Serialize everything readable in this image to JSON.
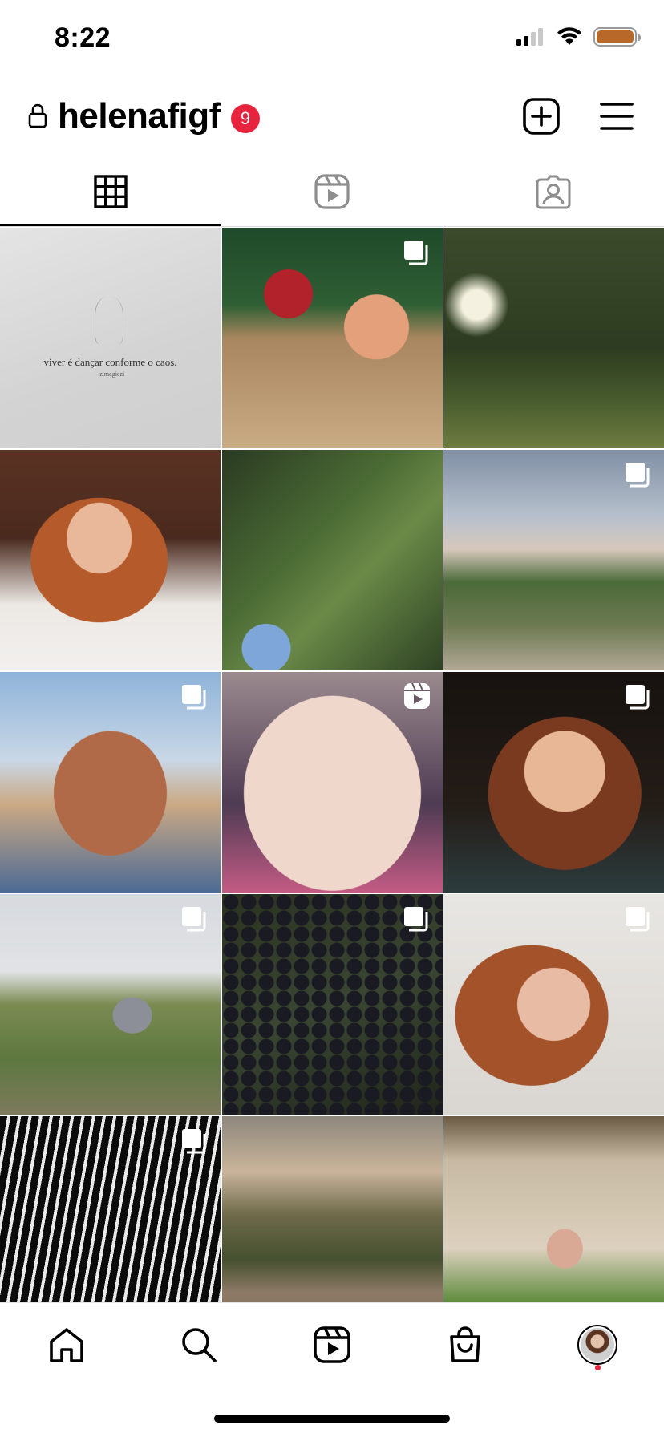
{
  "status_bar": {
    "time": "8:22",
    "signal_icon": "cellular-signal-icon",
    "wifi_icon": "wifi-icon",
    "battery_icon": "battery-icon",
    "battery_color": "#b8692a"
  },
  "header": {
    "username": "helenafigf",
    "private_icon": "lock-icon",
    "notification_count": "9",
    "badge_color": "#e8233e",
    "create_icon": "plus-square-icon",
    "menu_icon": "hamburger-menu-icon"
  },
  "tabs": [
    {
      "icon": "grid-icon",
      "active": true
    },
    {
      "icon": "reels-icon",
      "active": false
    },
    {
      "icon": "tagged-icon",
      "active": false
    }
  ],
  "posts": [
    {
      "kind": "photo",
      "quote": "viver é dançar conforme o caos.",
      "quote_author": "- z.magiezi"
    },
    {
      "kind": "carousel"
    },
    {
      "kind": "photo"
    },
    {
      "kind": "photo"
    },
    {
      "kind": "photo"
    },
    {
      "kind": "carousel"
    },
    {
      "kind": "carousel"
    },
    {
      "kind": "reel"
    },
    {
      "kind": "carousel"
    },
    {
      "kind": "carousel"
    },
    {
      "kind": "carousel"
    },
    {
      "kind": "carousel"
    },
    {
      "kind": "carousel"
    },
    {
      "kind": "photo"
    },
    {
      "kind": "photo"
    }
  ],
  "bottom_nav": [
    {
      "icon": "home-icon"
    },
    {
      "icon": "search-icon"
    },
    {
      "icon": "reels-icon"
    },
    {
      "icon": "shop-icon"
    },
    {
      "icon": "profile-avatar",
      "has_notification": true
    }
  ]
}
